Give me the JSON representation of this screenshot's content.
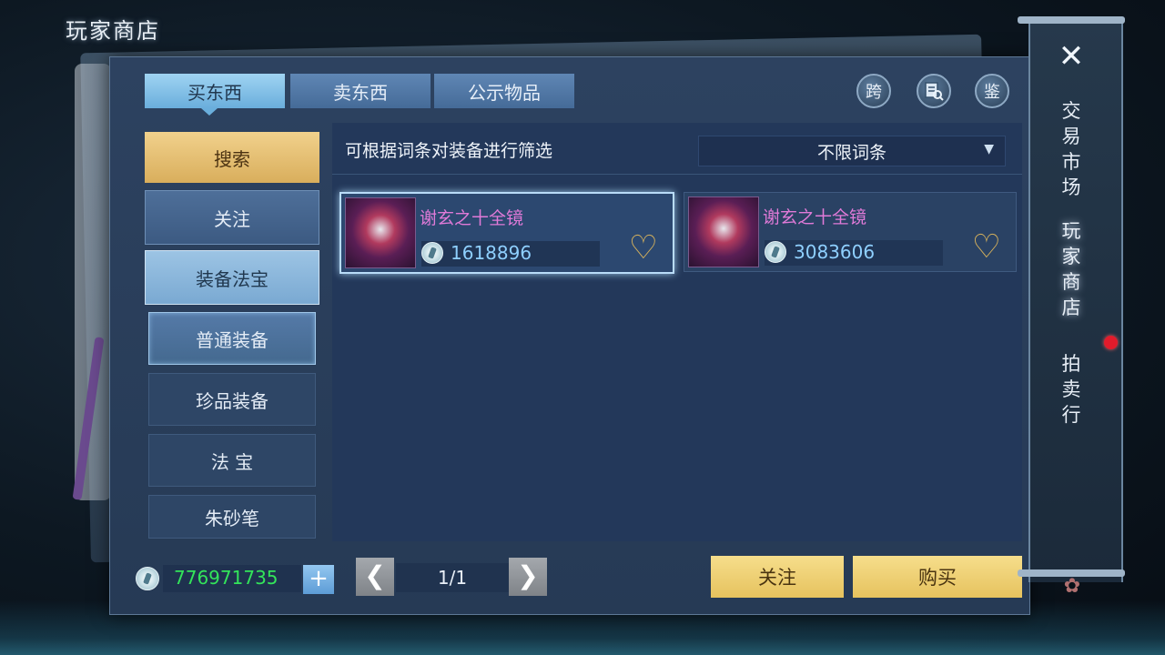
{
  "page_title": "玩家商店",
  "tabs": [
    {
      "label": "买东西",
      "active": true
    },
    {
      "label": "卖东西",
      "active": false
    },
    {
      "label": "公示物品",
      "active": false
    }
  ],
  "top_buttons": {
    "cross": "跨",
    "search_icon": "search-book-icon",
    "appraise": "鉴"
  },
  "sidebar": {
    "search": "搜索",
    "follow": "关注",
    "category": "装备法宝",
    "subcategories": [
      "普通装备",
      "珍品装备",
      "法 宝",
      "朱砂笔"
    ]
  },
  "filter": {
    "label": "可根据词条对装备进行筛选",
    "dropdown_value": "不限词条"
  },
  "items": [
    {
      "name": "谢玄之十全镜",
      "price": "1618896",
      "selected": true
    },
    {
      "name": "谢玄之十全镜",
      "price": "3083606",
      "selected": false
    }
  ],
  "bottom": {
    "wallet": "776971735",
    "plus": "+",
    "page": "1/1",
    "prev": "❮",
    "next": "❯",
    "follow_button": "关注",
    "buy_button": "购买"
  },
  "right_menu": {
    "close": "✕",
    "items": [
      "交易市场",
      "玩家商店",
      "拍卖行"
    ],
    "active_index": 1
  },
  "colors": {
    "gold": "#e6c25e",
    "wallet_green": "#33e45a",
    "price_blue": "#8fd0ff",
    "item_name_pink": "#e07ad8"
  }
}
